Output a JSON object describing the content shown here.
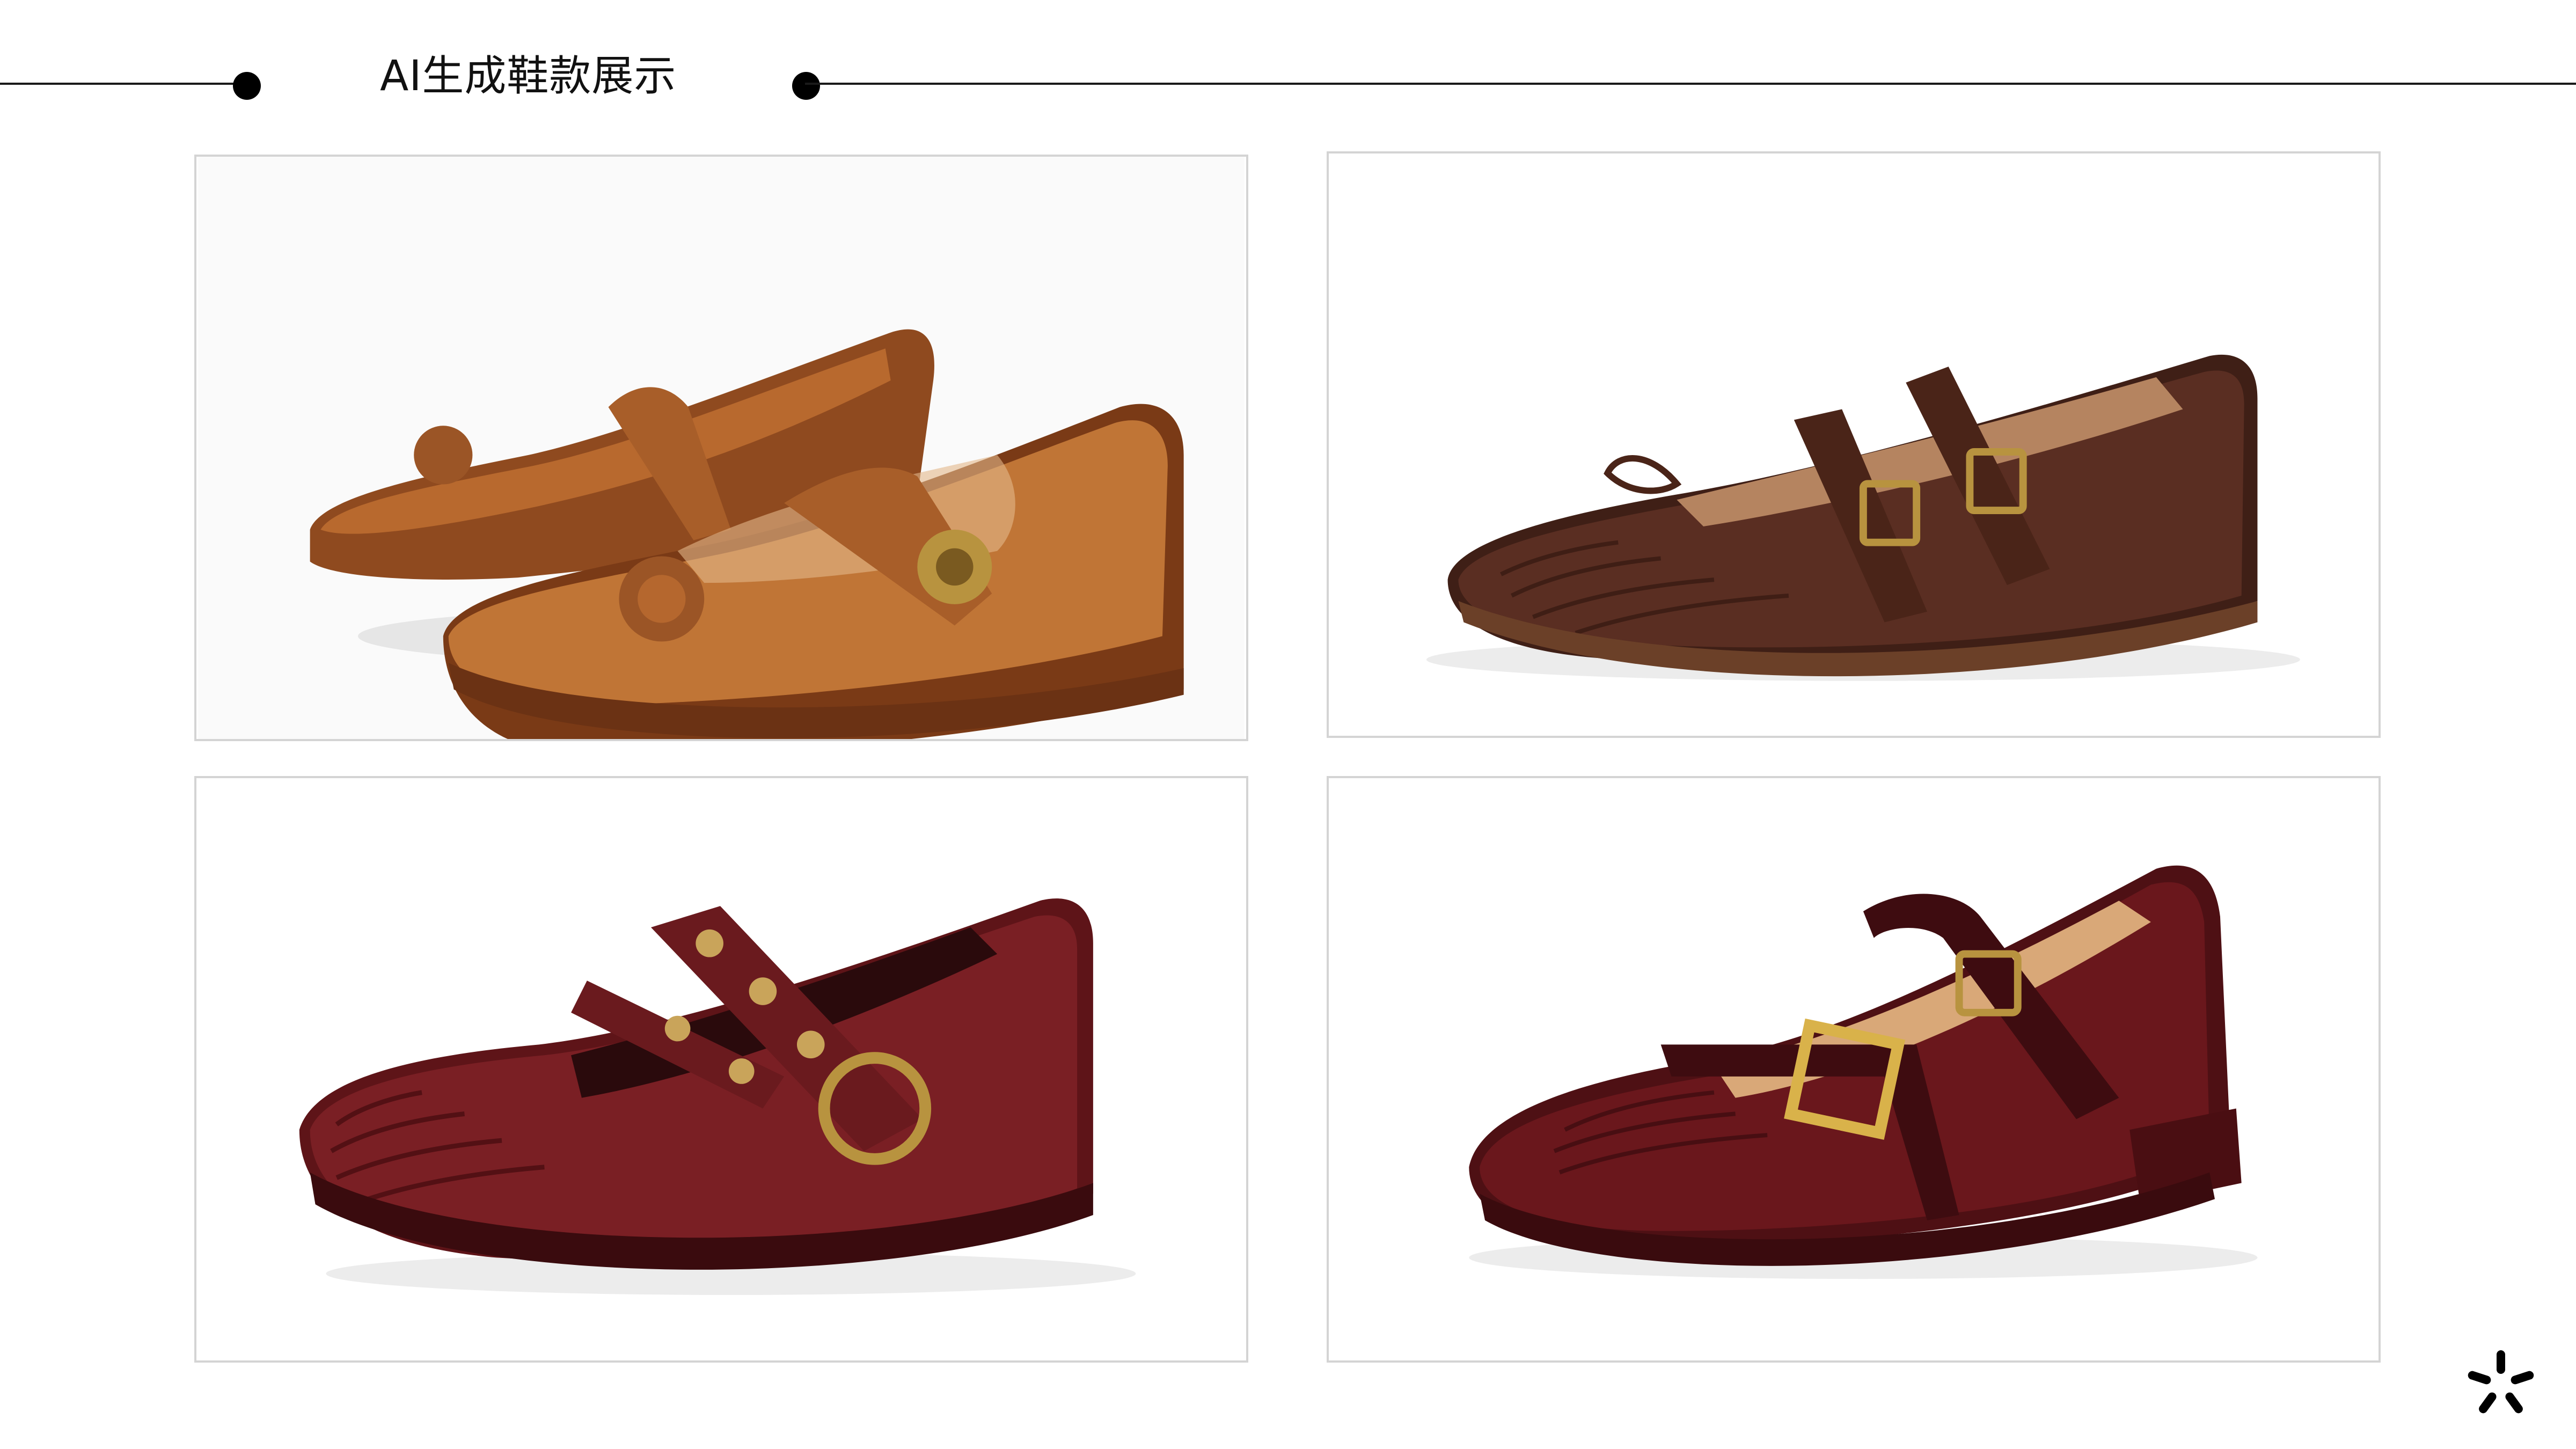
{
  "header": {
    "title": "AI生成鞋款展示"
  },
  "gallery": {
    "items": [
      {
        "id": "tan-flower-mary-jane",
        "icon": "tan-leather-shoe-pair"
      },
      {
        "id": "brown-double-buckle",
        "icon": "dark-brown-shoe"
      },
      {
        "id": "burgundy-studded",
        "icon": "burgundy-studded-shoe"
      },
      {
        "id": "oxblood-gold-buckle",
        "icon": "oxblood-patent-shoe"
      }
    ]
  },
  "colors": {
    "accent": "#000000",
    "frame_border": "#d4d4d4",
    "tan": "#b8692e",
    "dark_brown": "#5a2e22",
    "burgundy": "#7a1f24",
    "oxblood": "#5e1418",
    "brass": "#b8933f"
  }
}
